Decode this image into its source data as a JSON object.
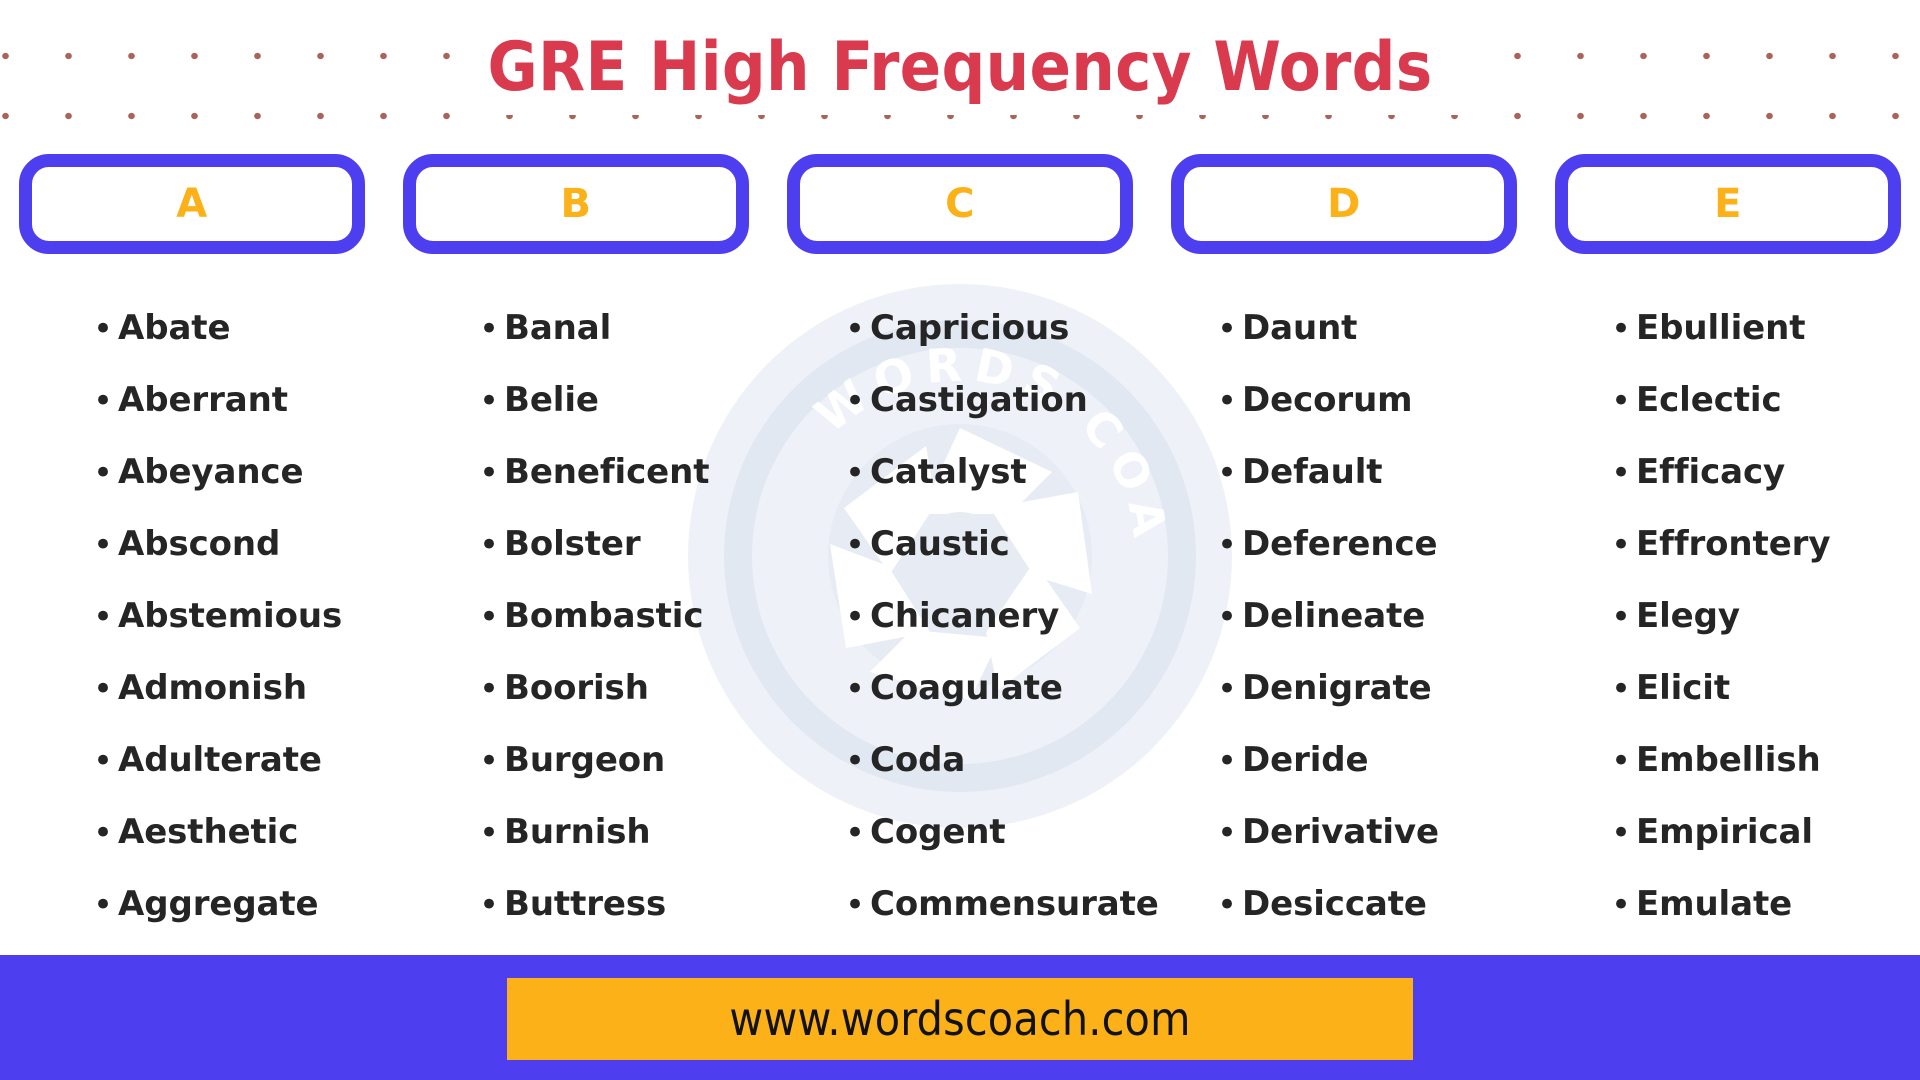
{
  "header": {
    "title": "GRE High Frequency Words",
    "title_color": "#d93a4e",
    "dot_color": "#a9635a"
  },
  "theme": {
    "badge_border": "#4d3ff0",
    "badge_letter": "#fbb117",
    "word_color": "#252525",
    "footer_band": "#4d3ff0",
    "url_box": "#fbb117",
    "watermark": "#e2e8f2",
    "page_background": "#ffffff"
  },
  "watermark": {
    "text_top": "WORDS",
    "text_bottom": "COACH",
    "icon": "aperture-icon"
  },
  "columns": [
    {
      "letter": "A",
      "words": [
        "Abate",
        "Aberrant",
        "Abeyance",
        "Abscond",
        "Abstemious",
        "Admonish",
        "Adulterate",
        "Aesthetic",
        "Aggregate"
      ]
    },
    {
      "letter": "B",
      "words": [
        "Banal",
        "Belie",
        "Beneficent",
        "Bolster",
        "Bombastic",
        "Boorish",
        "Burgeon",
        "Burnish",
        "Buttress"
      ]
    },
    {
      "letter": "C",
      "words": [
        "Capricious",
        "Castigation",
        "Catalyst",
        "Caustic",
        "Chicanery",
        "Coagulate",
        "Coda",
        "Cogent",
        "Commensurate"
      ]
    },
    {
      "letter": "D",
      "words": [
        "Daunt",
        "Decorum",
        "Default",
        "Deference",
        "Delineate",
        "Denigrate",
        "Deride",
        "Derivative",
        "Desiccate"
      ]
    },
    {
      "letter": "E",
      "words": [
        "Ebullient",
        "Eclectic",
        "Efficacy",
        "Effrontery",
        "Elegy",
        "Elicit",
        "Embellish",
        "Empirical",
        "Emulate"
      ]
    }
  ],
  "footer": {
    "url": "www.wordscoach.com"
  }
}
